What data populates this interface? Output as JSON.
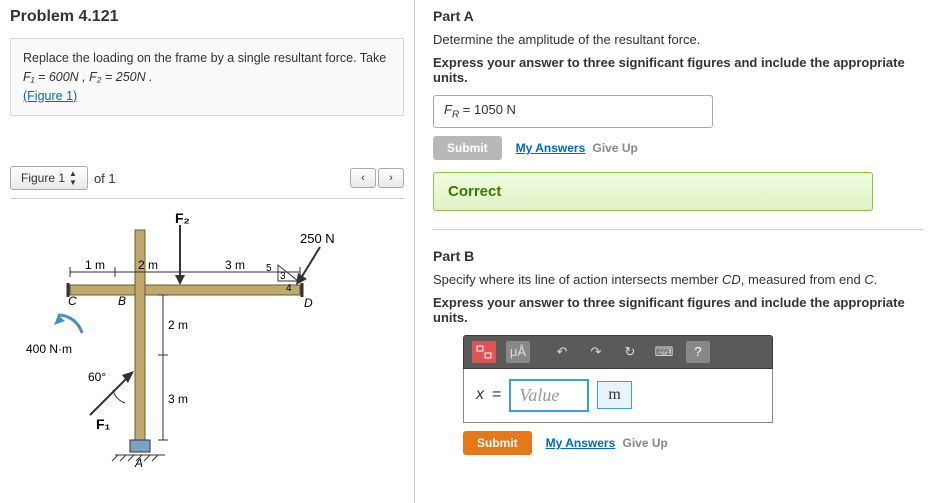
{
  "problem": {
    "title": "Problem 4.121",
    "instruction_pre": "Replace the loading on the frame by a single resultant force. Take ",
    "instruction_vals": "F₁ = 600N , F₂ = 250N .",
    "figure_link": "(Figure 1)"
  },
  "figure_nav": {
    "label": "Figure 1",
    "of": "of 1",
    "prev": "‹",
    "next": "›"
  },
  "figure": {
    "F2": "F₂",
    "F1": "F₁",
    "load_250": "250 N",
    "moment": "400 N·m",
    "angle": "60°",
    "dim_1m": "1 m",
    "dim_2m_h": "2 m",
    "dim_3m_h": "3 m",
    "dim_2m_v": "2 m",
    "dim_3m_v": "3 m",
    "ptA": "A",
    "ptB": "B",
    "ptC": "C",
    "ptD": "D",
    "slope3": "3",
    "slope4": "4",
    "slope5": "5"
  },
  "partA": {
    "title": "Part A",
    "desc": "Determine the amplitude of the resultant force.",
    "hint": "Express your answer to three significant figures and include the appropriate units.",
    "answer_var": "F",
    "answer_sub": "R",
    "answer_eq": " =   ",
    "answer_val": "1050 N",
    "submit": "Submit",
    "my_answers": "My Answers",
    "give_up": "Give Up",
    "correct": "Correct"
  },
  "partB": {
    "title": "Part B",
    "desc_pre": "Specify where its line of action intersects member ",
    "desc_cd": "CD",
    "desc_mid": ", measured from end ",
    "desc_c": "C",
    "desc_end": ".",
    "hint": "Express your answer to three significant figures and include the appropriate units.",
    "toolbar": {
      "mu": "μÅ",
      "undo": "↶",
      "redo": "↷",
      "reset": "↻",
      "keyboard": "⌨",
      "help": "?"
    },
    "var": "x",
    "eq": "=",
    "placeholder": "Value",
    "unit": "m",
    "submit": "Submit",
    "my_answers": "My Answers",
    "give_up": "Give Up"
  }
}
